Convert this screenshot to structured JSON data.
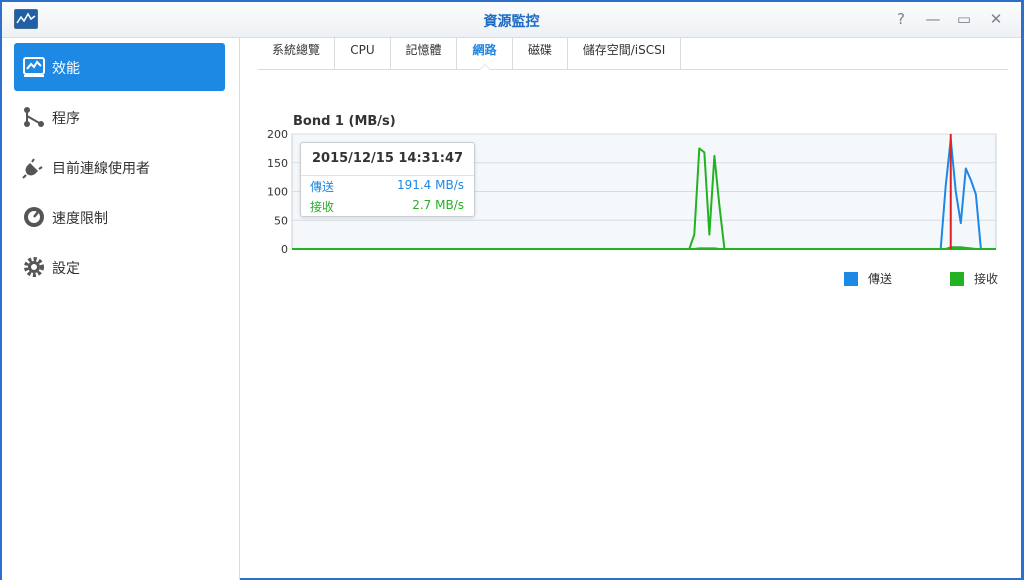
{
  "window": {
    "title": "資源監控",
    "controls": [
      "?",
      "—",
      "▭",
      "✕"
    ]
  },
  "sidebar": {
    "items": [
      {
        "label": "效能",
        "icon": "performance-chart-icon",
        "active": true
      },
      {
        "label": "程序",
        "icon": "process-icon",
        "active": false
      },
      {
        "label": "目前連線使用者",
        "icon": "plug-icon",
        "active": false
      },
      {
        "label": "速度限制",
        "icon": "speedometer-icon",
        "active": false
      },
      {
        "label": "設定",
        "icon": "gear-icon",
        "active": false
      }
    ]
  },
  "tabs": [
    {
      "label": "系統總覽",
      "active": false
    },
    {
      "label": "CPU",
      "active": false
    },
    {
      "label": "記憶體",
      "active": false
    },
    {
      "label": "網路",
      "active": true
    },
    {
      "label": "磁碟",
      "active": false
    },
    {
      "label": "儲存空間/iSCSI",
      "active": false
    }
  ],
  "tooltip": {
    "time": "2015/12/15 14:31:47",
    "send_label": "傳送",
    "send_value": "191.4 MB/s",
    "recv_label": "接收",
    "recv_value": "2.7 MB/s"
  },
  "colors": {
    "accent": "#1e88e5",
    "send": "#1e88e5",
    "recv": "#22b222",
    "cursor": "#e02020"
  },
  "chart_data": {
    "type": "line",
    "title": "Bond 1 (MB/s)",
    "ylim": [
      0,
      200
    ],
    "yticks": [
      0,
      50,
      100,
      150,
      200
    ],
    "x_points": 140,
    "cursor_index": 131,
    "grid": true,
    "legend_position": "bottom-right",
    "series": [
      {
        "name": "傳送",
        "color": "#1e88e5",
        "points": [
          [
            0,
            0
          ],
          [
            80,
            0
          ],
          [
            81,
            1
          ],
          [
            82,
            1
          ],
          [
            83,
            1
          ],
          [
            84,
            1
          ],
          [
            85,
            0
          ],
          [
            129,
            0
          ],
          [
            130,
            110
          ],
          [
            131,
            191
          ],
          [
            132,
            100
          ],
          [
            133,
            45
          ],
          [
            134,
            140
          ],
          [
            135,
            120
          ],
          [
            136,
            95
          ],
          [
            137,
            0
          ],
          [
            140,
            0
          ]
        ]
      },
      {
        "name": "接收",
        "color": "#22b222",
        "points": [
          [
            0,
            0
          ],
          [
            79,
            0
          ],
          [
            80,
            25
          ],
          [
            81,
            175
          ],
          [
            82,
            168
          ],
          [
            83,
            25
          ],
          [
            84,
            162
          ],
          [
            85,
            75
          ],
          [
            86,
            0
          ],
          [
            130,
            0
          ],
          [
            131,
            3
          ],
          [
            132,
            3
          ],
          [
            133,
            3
          ],
          [
            134,
            2
          ],
          [
            135,
            1
          ],
          [
            136,
            0
          ],
          [
            140,
            0
          ]
        ]
      }
    ]
  }
}
